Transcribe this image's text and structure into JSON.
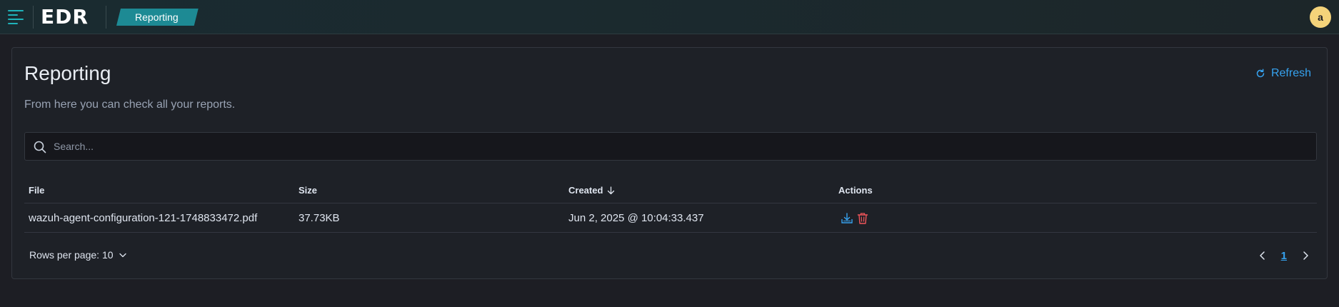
{
  "header": {
    "logo": "EDR",
    "breadcrumb": "Reporting",
    "avatar_initial": "a"
  },
  "page": {
    "title": "Reporting",
    "subtitle": "From here you can check all your reports.",
    "refresh_label": "Refresh"
  },
  "search": {
    "placeholder": "Search...",
    "value": ""
  },
  "table": {
    "columns": {
      "file": "File",
      "size": "Size",
      "created": "Created",
      "actions": "Actions"
    },
    "sort": {
      "column": "Created",
      "direction": "descending",
      "icon": "arrow-down-icon"
    },
    "rows": [
      {
        "file": "wazuh-agent-configuration-121-1748833472.pdf",
        "size": "37.73KB",
        "created": "Jun 2, 2025 @ 10:04:33.437"
      }
    ]
  },
  "pagination": {
    "rows_per_page_label": "Rows per page: 10",
    "current_page": "1"
  },
  "colors": {
    "accent": "#1fb3ba",
    "breadcrumb_bg": "#1d8a94",
    "link": "#36a2ef",
    "danger": "#f0555a",
    "avatar_bg": "#f4d37a",
    "background": "#1d1e24",
    "panel": "#1e2127"
  },
  "icons": {
    "menu": "hamburger-menu-icon",
    "refresh": "refresh-icon",
    "search": "search-icon",
    "download": "download-icon",
    "delete": "trash-icon",
    "rows_dropdown": "chevron-down-icon",
    "prev": "chevron-left-icon",
    "next": "chevron-right-icon"
  }
}
